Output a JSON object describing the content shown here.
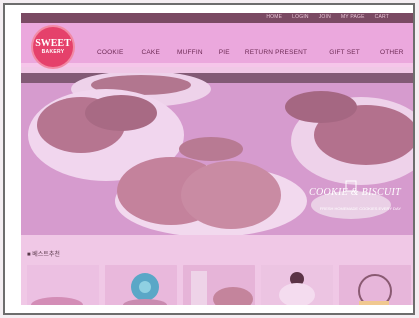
{
  "brand": {
    "line1": "SWEET",
    "line2": "BAKERY"
  },
  "utility_links": [
    "HOME",
    "LOGIN",
    "JOIN",
    "MY PAGE",
    "CART"
  ],
  "menu": [
    "COOKIE",
    "CAKE",
    "MUFFIN",
    "PIE",
    "RETURN PRESENT",
    "GIFT SET",
    "OTHER"
  ],
  "hero": {
    "title": "COOKIE & BISCUIT",
    "subtitle": "FRESH HOMEMADE COOKIES EVERY DAY"
  },
  "section": {
    "title": "■ 베스트추천"
  },
  "colors": {
    "nav_bg": "#eba8dd",
    "logo": "#e5416b",
    "page_tint": "#f0c8e6"
  }
}
